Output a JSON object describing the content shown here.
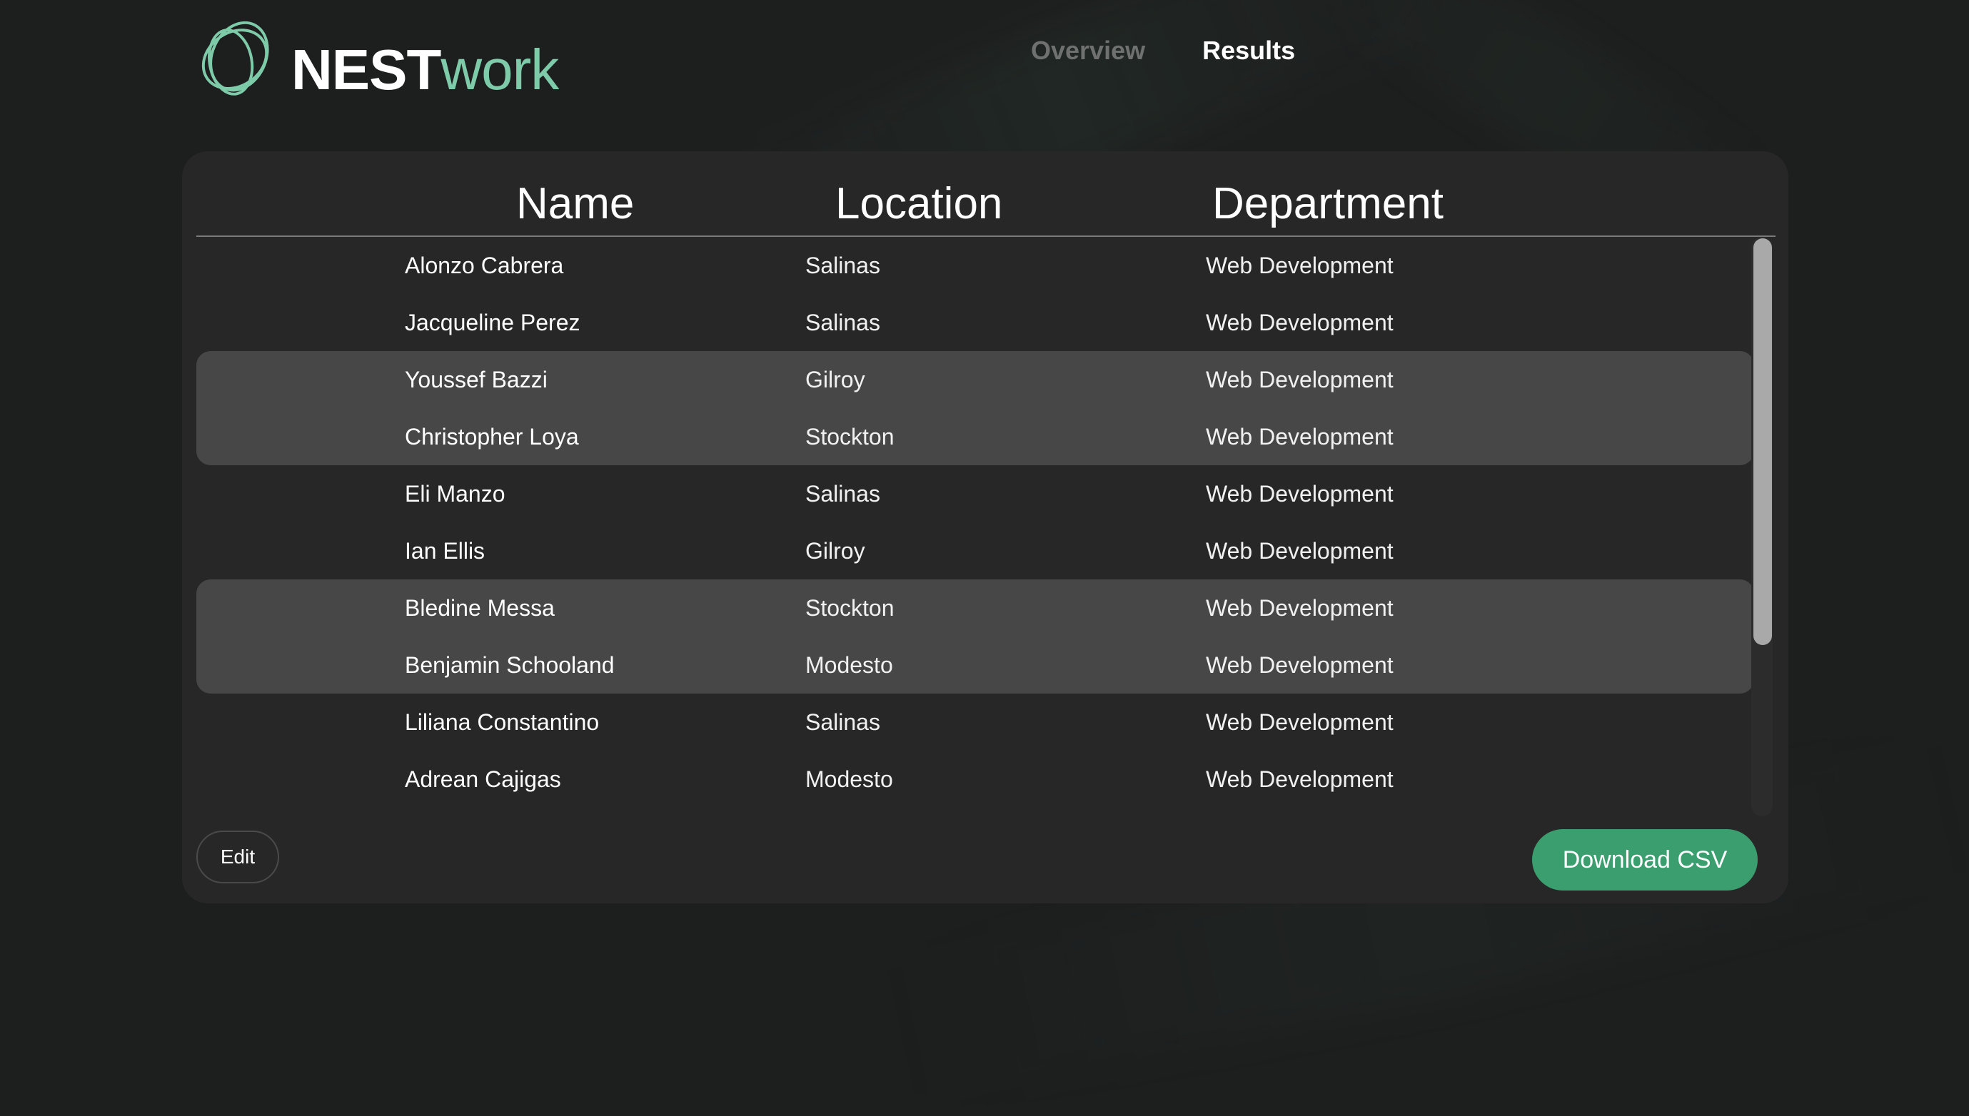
{
  "brand": {
    "name_bold": "NEST",
    "name_light": "work",
    "accent_color": "#7ecbaa"
  },
  "nav": {
    "items": [
      {
        "label": "Overview",
        "active": false
      },
      {
        "label": "Results",
        "active": true
      }
    ]
  },
  "table": {
    "columns": [
      "Name",
      "Location",
      "Department"
    ],
    "rows": [
      {
        "name": "Alonzo Cabrera",
        "location": "Salinas",
        "department": "Web Development"
      },
      {
        "name": "Jacqueline Perez",
        "location": "Salinas",
        "department": "Web Development"
      },
      {
        "name": "Youssef Bazzi",
        "location": "Gilroy",
        "department": "Web Development"
      },
      {
        "name": "Christopher Loya",
        "location": "Stockton",
        "department": "Web Development"
      },
      {
        "name": "Eli Manzo",
        "location": "Salinas",
        "department": "Web Development"
      },
      {
        "name": "Ian Ellis",
        "location": "Gilroy",
        "department": "Web Development"
      },
      {
        "name": "Bledine Messa",
        "location": "Stockton",
        "department": "Web Development"
      },
      {
        "name": "Benjamin Schooland",
        "location": "Modesto",
        "department": "Web Development"
      },
      {
        "name": "Liliana Constantino",
        "location": "Salinas",
        "department": "Web Development"
      },
      {
        "name": "Adrean Cajigas",
        "location": "Modesto",
        "department": "Web Development"
      }
    ]
  },
  "actions": {
    "edit_label": "Edit",
    "download_label": "Download CSV",
    "download_color": "#3a9e6e"
  }
}
